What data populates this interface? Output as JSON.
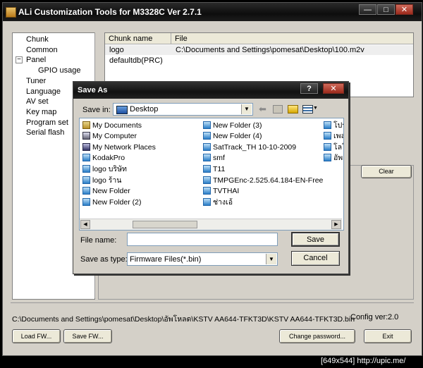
{
  "app": {
    "title": "ALi Customization Tools for M3328C  Ver 2.7.1",
    "window_buttons": {
      "minimize": "—",
      "maximize": "□",
      "close": "✕"
    }
  },
  "tree": {
    "items": [
      "Chunk",
      "Common",
      "Panel",
      "GPIO usage",
      "Tuner",
      "Language",
      "AV set",
      "Key map",
      "Program set",
      "Serial flash"
    ],
    "expander": "−"
  },
  "chunk_list": {
    "columns": [
      "Chunk name",
      "File"
    ],
    "rows": [
      [
        "logo",
        "C:\\Documents and Settings\\pomesat\\Desktop\\100.m2v"
      ],
      [
        "defaultdb(PRC)",
        ""
      ]
    ]
  },
  "buttons": {
    "clear": "Clear",
    "load_fw": "Load FW...",
    "save_fw": "Save FW...",
    "change_password": "Change password...",
    "exit": "Exit"
  },
  "status": {
    "path": "C:\\Documents and Settings\\pomesat\\Desktop\\อัพโหลด\\KSTV AA644-TFKT3D\\KSTV AA644-TFKT3D.bin",
    "config_label": "Config ver:",
    "config_value": "2.0"
  },
  "dialog": {
    "title": "Save As",
    "help": "?",
    "close": "✕",
    "save_in_label": "Save in:",
    "save_in_value": "Desktop",
    "file_name_label": "File name:",
    "file_name_value": "",
    "save_as_type_label": "Save as type:",
    "save_as_type_value": "Firmware Files(*.bin)",
    "save_button": "Save",
    "cancel_button": "Cancel",
    "files_col1": [
      {
        "name": "My Documents",
        "icon": "my-documents-icon"
      },
      {
        "name": "My Computer",
        "icon": "my-computer-icon"
      },
      {
        "name": "My Network Places",
        "icon": "network-icon"
      },
      {
        "name": "KodakPro",
        "icon": "folder-icon"
      },
      {
        "name": "logo บริษัท",
        "icon": "folder-icon"
      },
      {
        "name": "logo ร้าน",
        "icon": "folder-icon"
      },
      {
        "name": "New Folder",
        "icon": "folder-icon"
      },
      {
        "name": "New Folder (2)",
        "icon": "folder-icon"
      }
    ],
    "files_col2": [
      {
        "name": "New Folder (3)",
        "icon": "folder-icon"
      },
      {
        "name": "New Folder (4)",
        "icon": "folder-icon"
      },
      {
        "name": "SatTrack_TH 10-10-2009",
        "icon": "folder-icon"
      },
      {
        "name": "smf",
        "icon": "folder-icon"
      },
      {
        "name": "T11",
        "icon": "folder-icon"
      },
      {
        "name": "TMPGEnc-2.525.64.184-EN-Free",
        "icon": "folder-icon"
      },
      {
        "name": "TVTHAI",
        "icon": "folder-icon"
      },
      {
        "name": "ช่างเอ้",
        "icon": "folder-icon"
      }
    ],
    "files_col3": [
      {
        "name": "โปร",
        "icon": "folder-icon"
      },
      {
        "name": "เพล",
        "icon": "folder-icon"
      },
      {
        "name": "โลโ",
        "icon": "folder-icon"
      },
      {
        "name": "อัพ",
        "icon": "folder-icon"
      }
    ]
  },
  "watermark": "[649x544] http://upic.me/"
}
